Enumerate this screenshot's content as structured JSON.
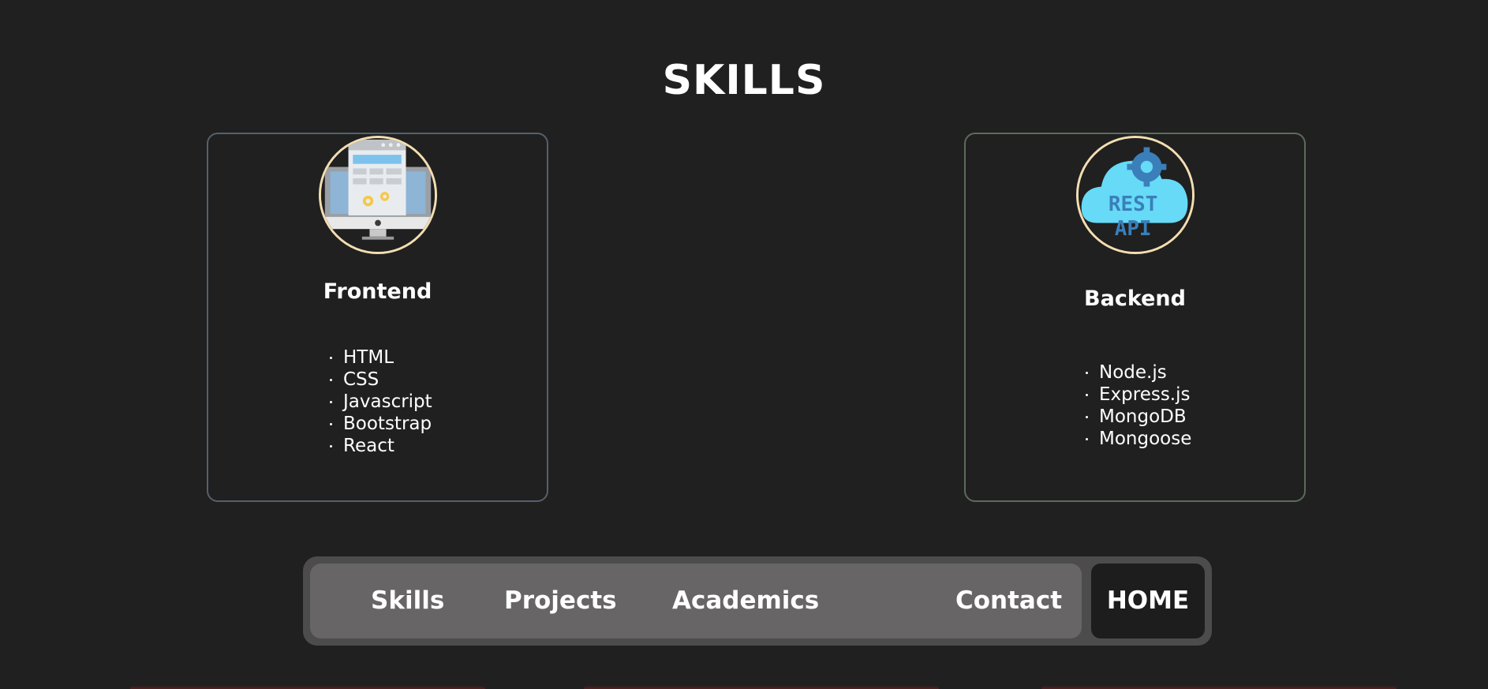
{
  "page": {
    "title": "SKILLS"
  },
  "cards": {
    "frontend": {
      "title": "Frontend",
      "icon": "desktop-web-design-icon",
      "items": [
        "HTML",
        "CSS",
        "Javascript",
        "Bootstrap",
        "React"
      ]
    },
    "backend": {
      "title": "Backend",
      "icon": "rest-api-cloud-icon",
      "icon_text_line1": "REST",
      "icon_text_line2": "API",
      "items": [
        "Node.js",
        "Express.js",
        "MongoDB",
        "Mongoose"
      ]
    }
  },
  "nav": {
    "links": [
      "Skills",
      "Projects",
      "Academics",
      "Contact"
    ],
    "home": "HOME"
  },
  "colors": {
    "background": "#202020",
    "card_border_frontend": "#55606a",
    "card_border_backend": "#5b6b5b",
    "avatar_ring": "#f3deb2",
    "nav_outer": "#4c4c4d",
    "nav_inner": "#676566",
    "nav_home_bg": "#1d1d1d",
    "api_cloud": "#66daf7",
    "api_text": "#3a7fb9"
  }
}
